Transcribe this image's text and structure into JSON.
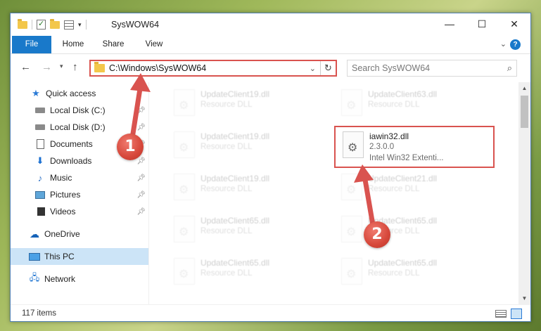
{
  "window": {
    "title": "SysWOW64",
    "controls": {
      "minimize": "—",
      "maximize": "☐",
      "close": "✕"
    }
  },
  "ribbon": {
    "tabs": [
      "File",
      "Home",
      "Share",
      "View"
    ],
    "help": "?"
  },
  "navigation": {
    "address": "C:\\Windows\\SysWOW64",
    "search_placeholder": "Search SysWOW64"
  },
  "sidebar": {
    "items": [
      {
        "label": "Quick access",
        "icon": "star-icon",
        "pinned": false
      },
      {
        "label": "Local Disk (C:)",
        "icon": "drive-icon",
        "pinned": true
      },
      {
        "label": "Local Disk (D:)",
        "icon": "drive-icon",
        "pinned": true
      },
      {
        "label": "Documents",
        "icon": "document-icon",
        "pinned": true
      },
      {
        "label": "Downloads",
        "icon": "download-icon",
        "pinned": true
      },
      {
        "label": "Music",
        "icon": "music-icon",
        "pinned": true
      },
      {
        "label": "Pictures",
        "icon": "pictures-icon",
        "pinned": true
      },
      {
        "label": "Videos",
        "icon": "videos-icon",
        "pinned": true
      },
      {
        "label": "OneDrive",
        "icon": "cloud-icon",
        "pinned": false
      },
      {
        "label": "This PC",
        "icon": "computer-icon",
        "selected": true
      },
      {
        "label": "Network",
        "icon": "network-icon",
        "pinned": false
      }
    ]
  },
  "files": [
    {
      "name": "UpdateClient19.dll",
      "type": "Resource DLL",
      "faded": true
    },
    {
      "name": "UpdateClient63.dll",
      "type": "Resource DLL",
      "faded": true
    },
    {
      "name": "UpdateClient19.dll",
      "type": "Resource DLL",
      "faded": true
    },
    {
      "name": "iawin32.dll",
      "version": "2.3.0.0",
      "description": "Intel Win32 Extenti...",
      "highlighted": true
    },
    {
      "name": "UpdateClient19.dll",
      "type": "Resource DLL",
      "faded": true
    },
    {
      "name": "UpdateClient21.dll",
      "type": "Resource DLL",
      "faded": true
    },
    {
      "name": "UpdateClient65.dll",
      "type": "Resource DLL",
      "faded": true
    },
    {
      "name": "UpdateClient65.dll",
      "type": "Resource DLL",
      "faded": true
    },
    {
      "name": "UpdateClient65.dll",
      "type": "Resource DLL",
      "faded": true
    },
    {
      "name": "UpdateClient65.dll",
      "type": "Resource DLL",
      "faded": true
    }
  ],
  "status": {
    "item_count": "117 items"
  },
  "annotations": {
    "badge_1": "1",
    "badge_2": "2",
    "color": "#d9534f"
  }
}
